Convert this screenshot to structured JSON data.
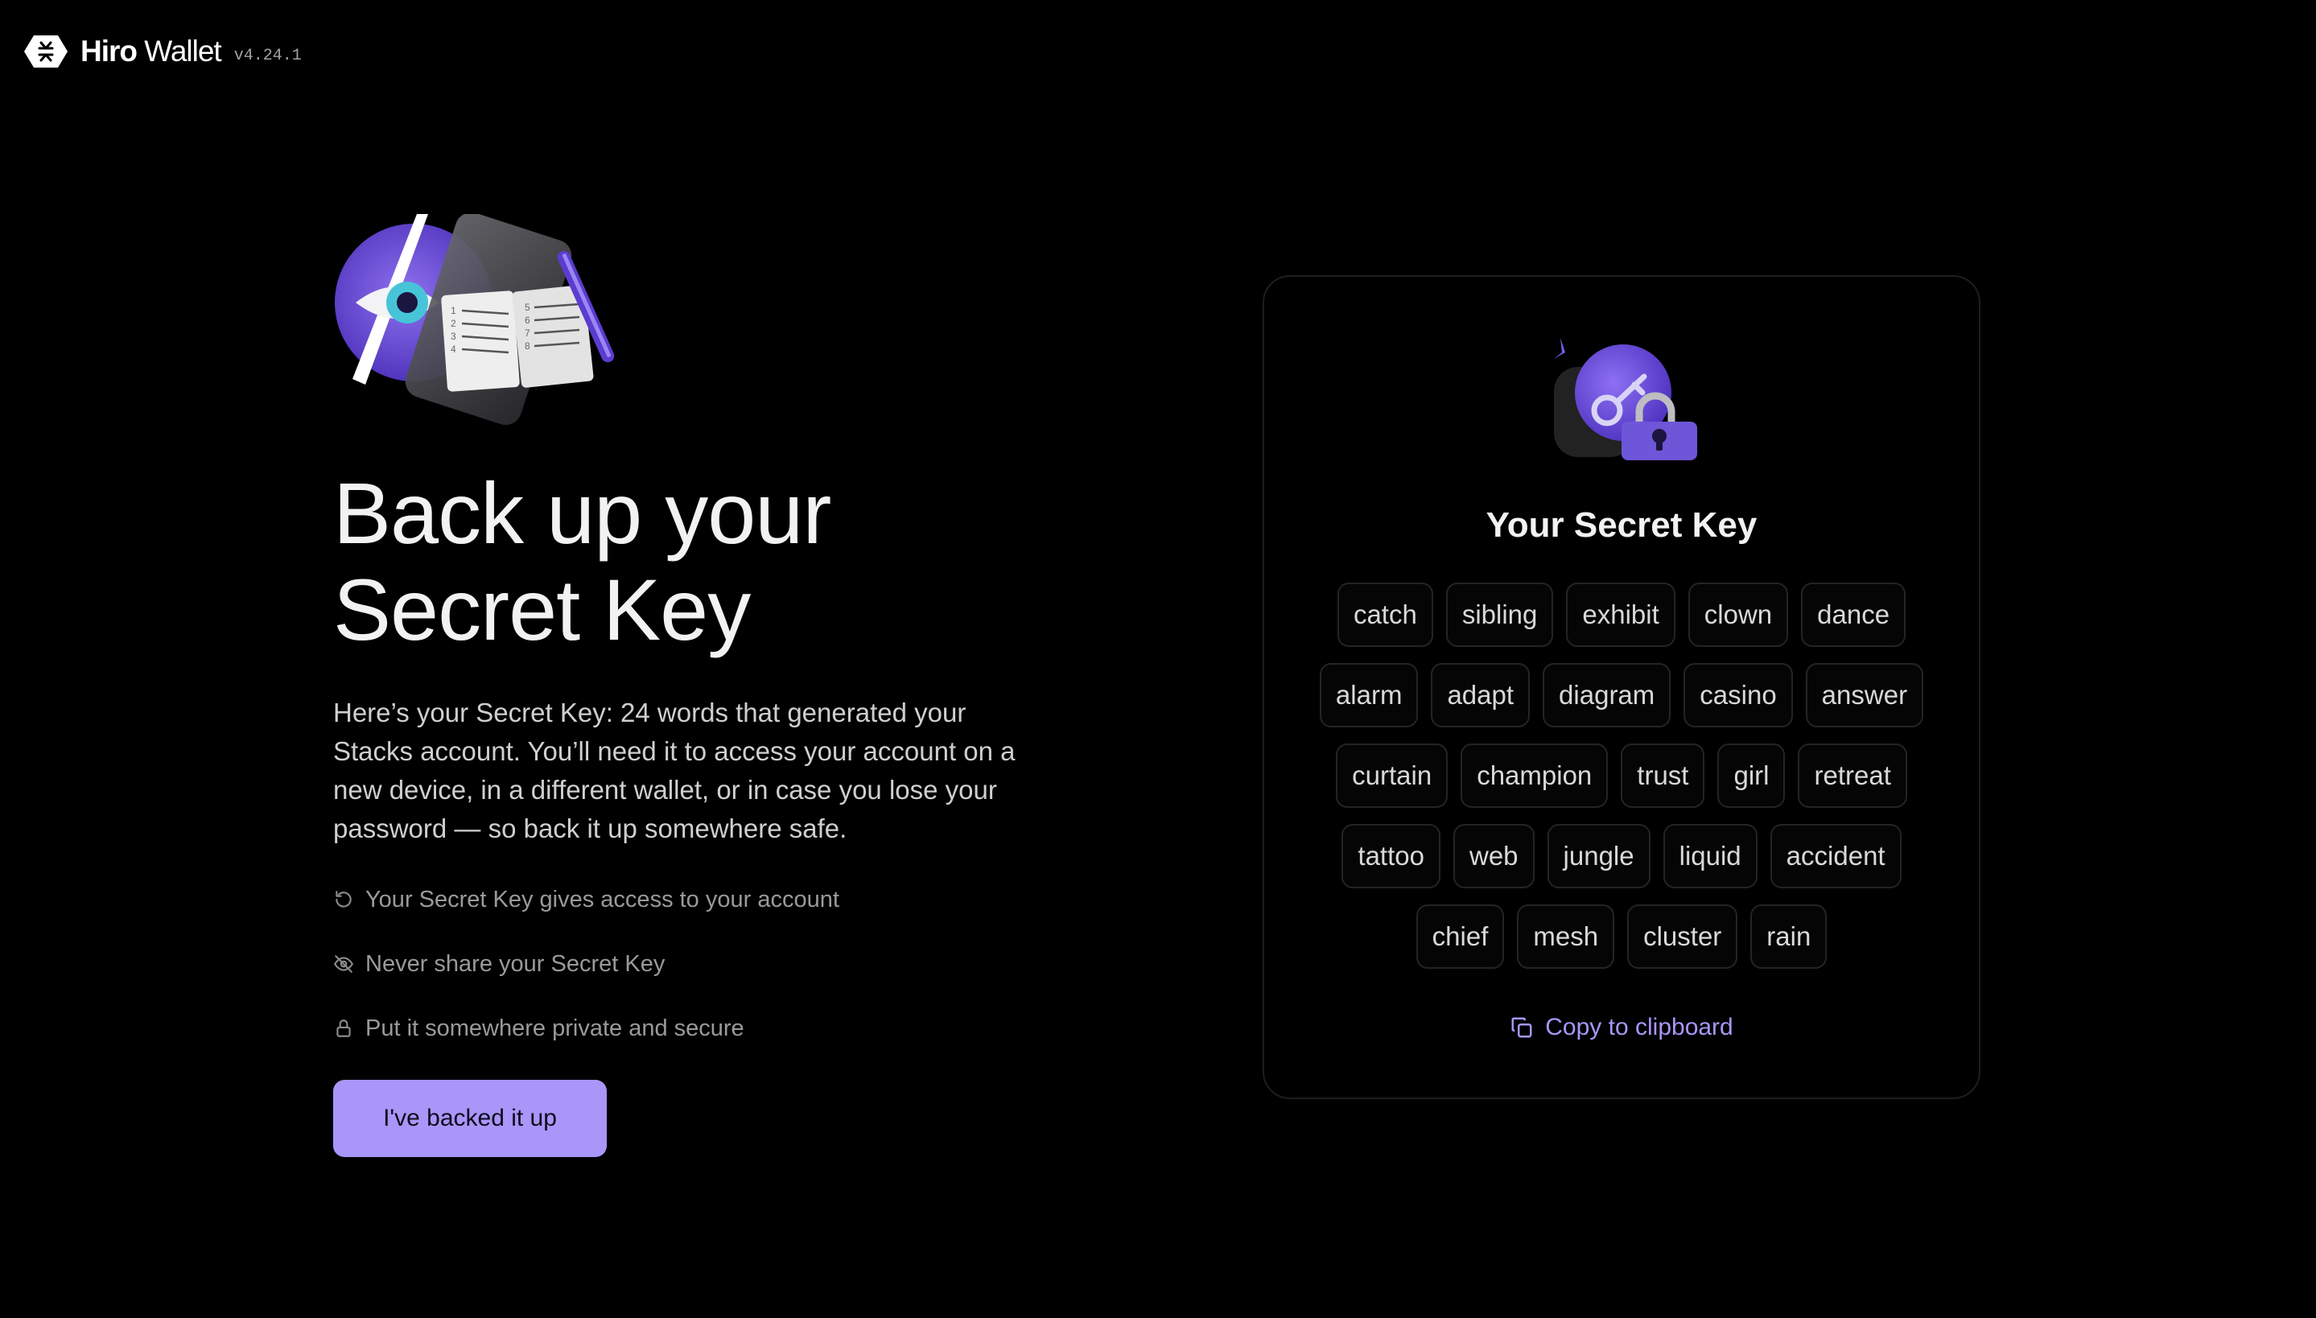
{
  "header": {
    "brand_strong": "Hiro",
    "brand_light": " Wallet",
    "version": "v4.24.1"
  },
  "main": {
    "title_line1": "Back up your",
    "title_line2": "Secret Key",
    "description": "Here’s your Secret Key: 24 words that generated your Stacks account. You’ll need it to access your account on a new device, in a different wallet, or in case you lose your password — so back it up somewhere safe.",
    "tips": [
      {
        "icon": "refresh-icon",
        "text": "Your Secret Key gives access to your account"
      },
      {
        "icon": "eye-off-icon",
        "text": "Never share your Secret Key"
      },
      {
        "icon": "lock-icon",
        "text": "Put it somewhere private and secure"
      }
    ],
    "confirm_button": "I've backed it up"
  },
  "secret_card": {
    "title": "Your Secret Key",
    "word_rows": [
      [
        "catch",
        "sibling",
        "exhibit",
        "clown",
        "dance"
      ],
      [
        "alarm",
        "adapt",
        "diagram",
        "casino",
        "answer"
      ],
      [
        "curtain",
        "champion",
        "trust",
        "girl",
        "retreat"
      ],
      [
        "tattoo",
        "web",
        "jungle",
        "liquid",
        "accident"
      ],
      [
        "chief",
        "mesh",
        "cluster",
        "rain"
      ]
    ],
    "copy_label": "Copy to clipboard"
  },
  "colors": {
    "background": "#000000",
    "accent": "#a996f9",
    "illustration_purple": "#6b4ed8",
    "text_primary": "#f2f2f2",
    "text_muted": "#9a9a9a"
  }
}
